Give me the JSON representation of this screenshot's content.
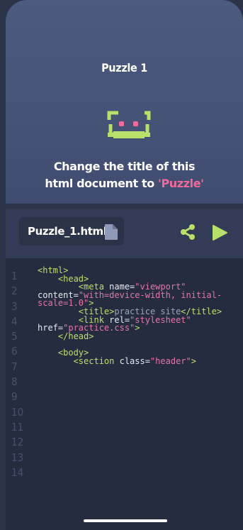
{
  "puzzle": {
    "title": "Puzzle 1",
    "instruction_line1": "Change the title of this",
    "instruction_prefix": "html document to ",
    "instruction_highlight": "'Puzzle'"
  },
  "file": {
    "name": "Puzzle_1.html"
  },
  "colors": {
    "accent": "#b9e06a",
    "highlight": "#f06a9b",
    "background_top": "#4d5a80",
    "editor_bg": "#262c40"
  },
  "icons": {
    "mascot": "robot-icon",
    "file": "document-icon",
    "share": "share-icon",
    "run": "play-icon"
  },
  "editor": {
    "line_numbers": [
      "1",
      "2",
      "3",
      "4",
      "5",
      "6",
      "7",
      "8",
      "9",
      "10",
      "11",
      "12",
      "13",
      "14"
    ],
    "code": {
      "l1_open": "<html>",
      "l2_open": "<head>",
      "l3_tag": "<meta",
      "l3_attr1": " name=",
      "l3_val1": "\"viewport\"",
      "l3_attr2": "content=",
      "l3_val2a": "\"with=device-width, initial-",
      "l3_val2b": "scale=1.0\"",
      "l3_close": ">",
      "l4_open": "<title>",
      "l4_text": "practice site",
      "l4_close": "</title>",
      "l5_tag": "<link",
      "l5_attr1": " rel=",
      "l5_val1": "\"stylesheet\"",
      "l5_attr2": "href=",
      "l5_val2": "\"practice.css\"",
      "l5_close": ">",
      "l6_close": "</head>",
      "l7_open": "<body>",
      "l8_tag": "<section",
      "l8_attr": " class=",
      "l8_val": "\"header\"",
      "l8_close": ">"
    }
  }
}
